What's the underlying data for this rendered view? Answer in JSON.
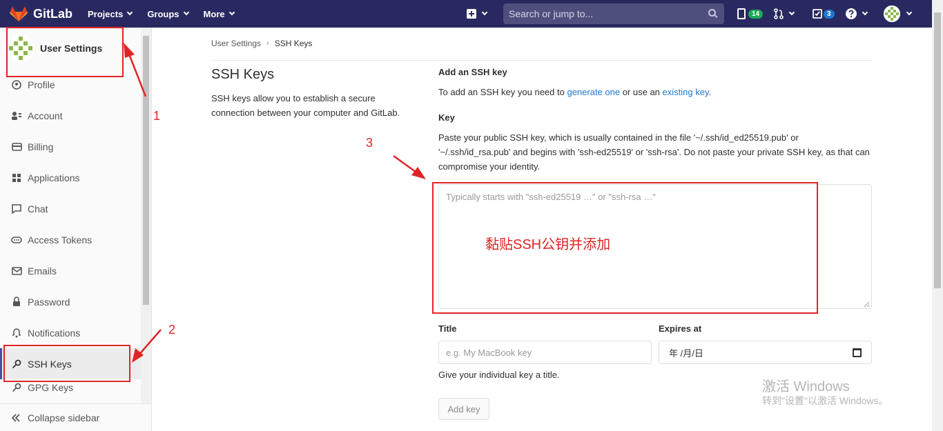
{
  "navbar": {
    "logo_text": "GitLab",
    "menu": [
      {
        "label": "Projects"
      },
      {
        "label": "Groups"
      },
      {
        "label": "More"
      }
    ],
    "search_placeholder": "Search or jump to...",
    "issues_count": "14",
    "todos_count": "3",
    "colors": {
      "bg": "#292961",
      "issues_badge": "#1aaa55",
      "todos_badge": "#1f78d1"
    }
  },
  "sidebar": {
    "title": "User Settings",
    "items": [
      {
        "label": "Profile",
        "icon": "profile-icon"
      },
      {
        "label": "Account",
        "icon": "account-icon"
      },
      {
        "label": "Billing",
        "icon": "billing-icon"
      },
      {
        "label": "Applications",
        "icon": "applications-icon"
      },
      {
        "label": "Chat",
        "icon": "chat-icon"
      },
      {
        "label": "Access Tokens",
        "icon": "access-tokens-icon"
      },
      {
        "label": "Emails",
        "icon": "emails-icon"
      },
      {
        "label": "Password",
        "icon": "lock-icon"
      },
      {
        "label": "Notifications",
        "icon": "bell-icon"
      },
      {
        "label": "SSH Keys",
        "icon": "key-icon",
        "active": true
      },
      {
        "label": "GPG Keys",
        "icon": "key-icon"
      }
    ],
    "collapse_label": "Collapse sidebar"
  },
  "breadcrumb": {
    "parent": "User Settings",
    "separator": "›",
    "current": "SSH Keys"
  },
  "main": {
    "title": "SSH Keys",
    "description": "SSH keys allow you to establish a secure connection between your computer and GitLab.",
    "add_heading": "Add an SSH key",
    "add_text_prefix": "To add an SSH key you need to ",
    "generate_link": "generate one",
    "add_text_mid": " or use an ",
    "existing_link": "existing key",
    "add_text_suffix": ".",
    "key_label": "Key",
    "key_help": "Paste your public SSH key, which is usually contained in the file '~/.ssh/id_ed25519.pub' or '~/.ssh/id_rsa.pub' and begins with 'ssh-ed25519' or 'ssh-rsa'. Do not paste your private SSH key, as that can compromise your identity.",
    "key_placeholder": "Typically starts with \"ssh-ed25519 …\" or \"ssh-rsa …\"",
    "title_label": "Title",
    "title_placeholder": "e.g. My MacBook key",
    "title_help": "Give your individual key a title.",
    "expires_label": "Expires at",
    "expires_value": "年 /月/日",
    "add_button": "Add key"
  },
  "annotations": {
    "num1": "1",
    "num2": "2",
    "num3": "3",
    "paste_hint": "黏贴SSH公钥并添加",
    "color": "#e02424"
  },
  "watermark": {
    "line1": "激活 Windows",
    "line2": "转到\"设置\"以激活 Windows。"
  }
}
